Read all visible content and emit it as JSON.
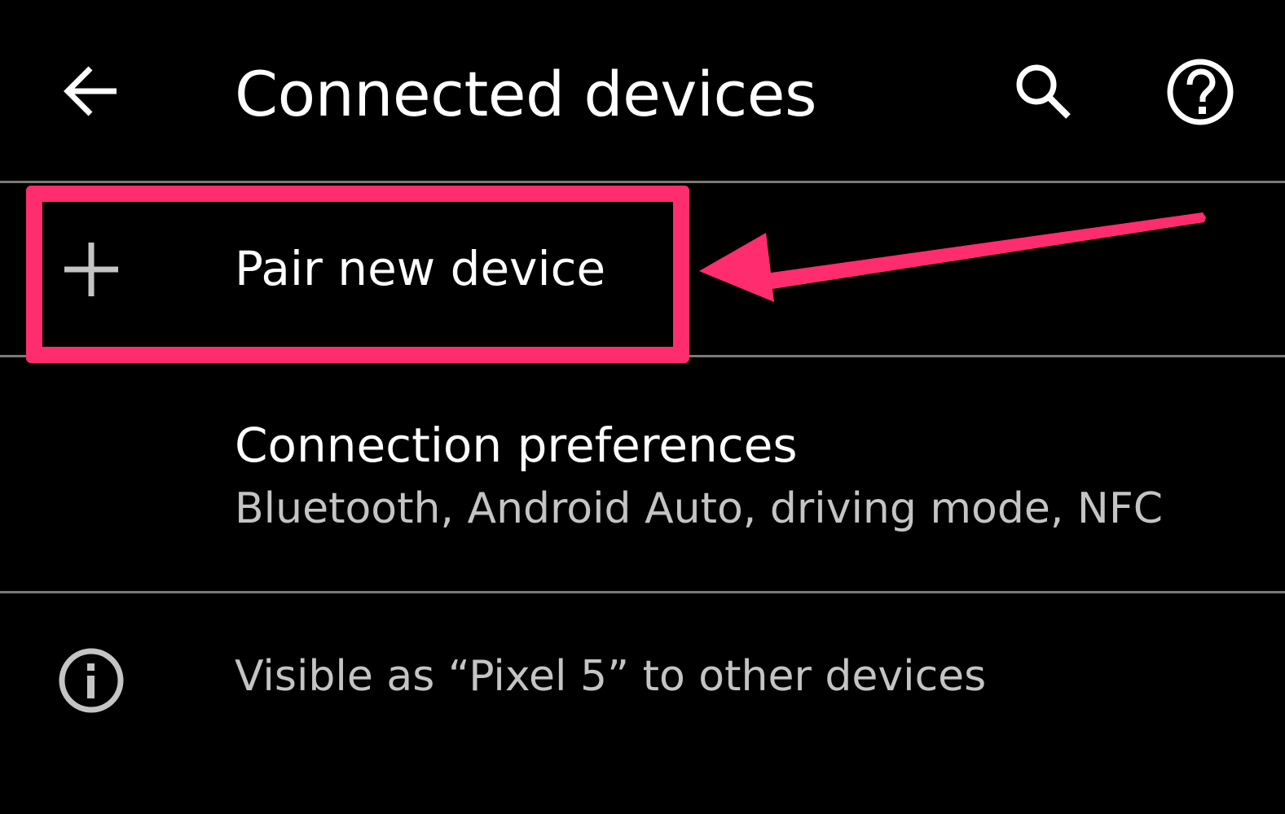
{
  "header": {
    "title": "Connected devices",
    "back_icon": "arrow-back-icon",
    "search_icon": "search-icon",
    "help_icon": "help-icon"
  },
  "rows": {
    "pair": {
      "icon": "plus-icon",
      "title": "Pair new device"
    },
    "preferences": {
      "title": "Connection preferences",
      "subtitle": "Bluetooth, Android Auto, driving mode, NFC"
    },
    "visible": {
      "icon": "info-icon",
      "text": "Visible as “Pixel 5” to other devices"
    }
  },
  "annotation": {
    "color": "#ff2d6f",
    "target": "Pair new device"
  },
  "colors": {
    "background": "#000000",
    "primary_text": "#ffffff",
    "secondary_text": "#c4c4c4",
    "divider": "#7a7a7a",
    "highlight": "#ff2d6f"
  }
}
